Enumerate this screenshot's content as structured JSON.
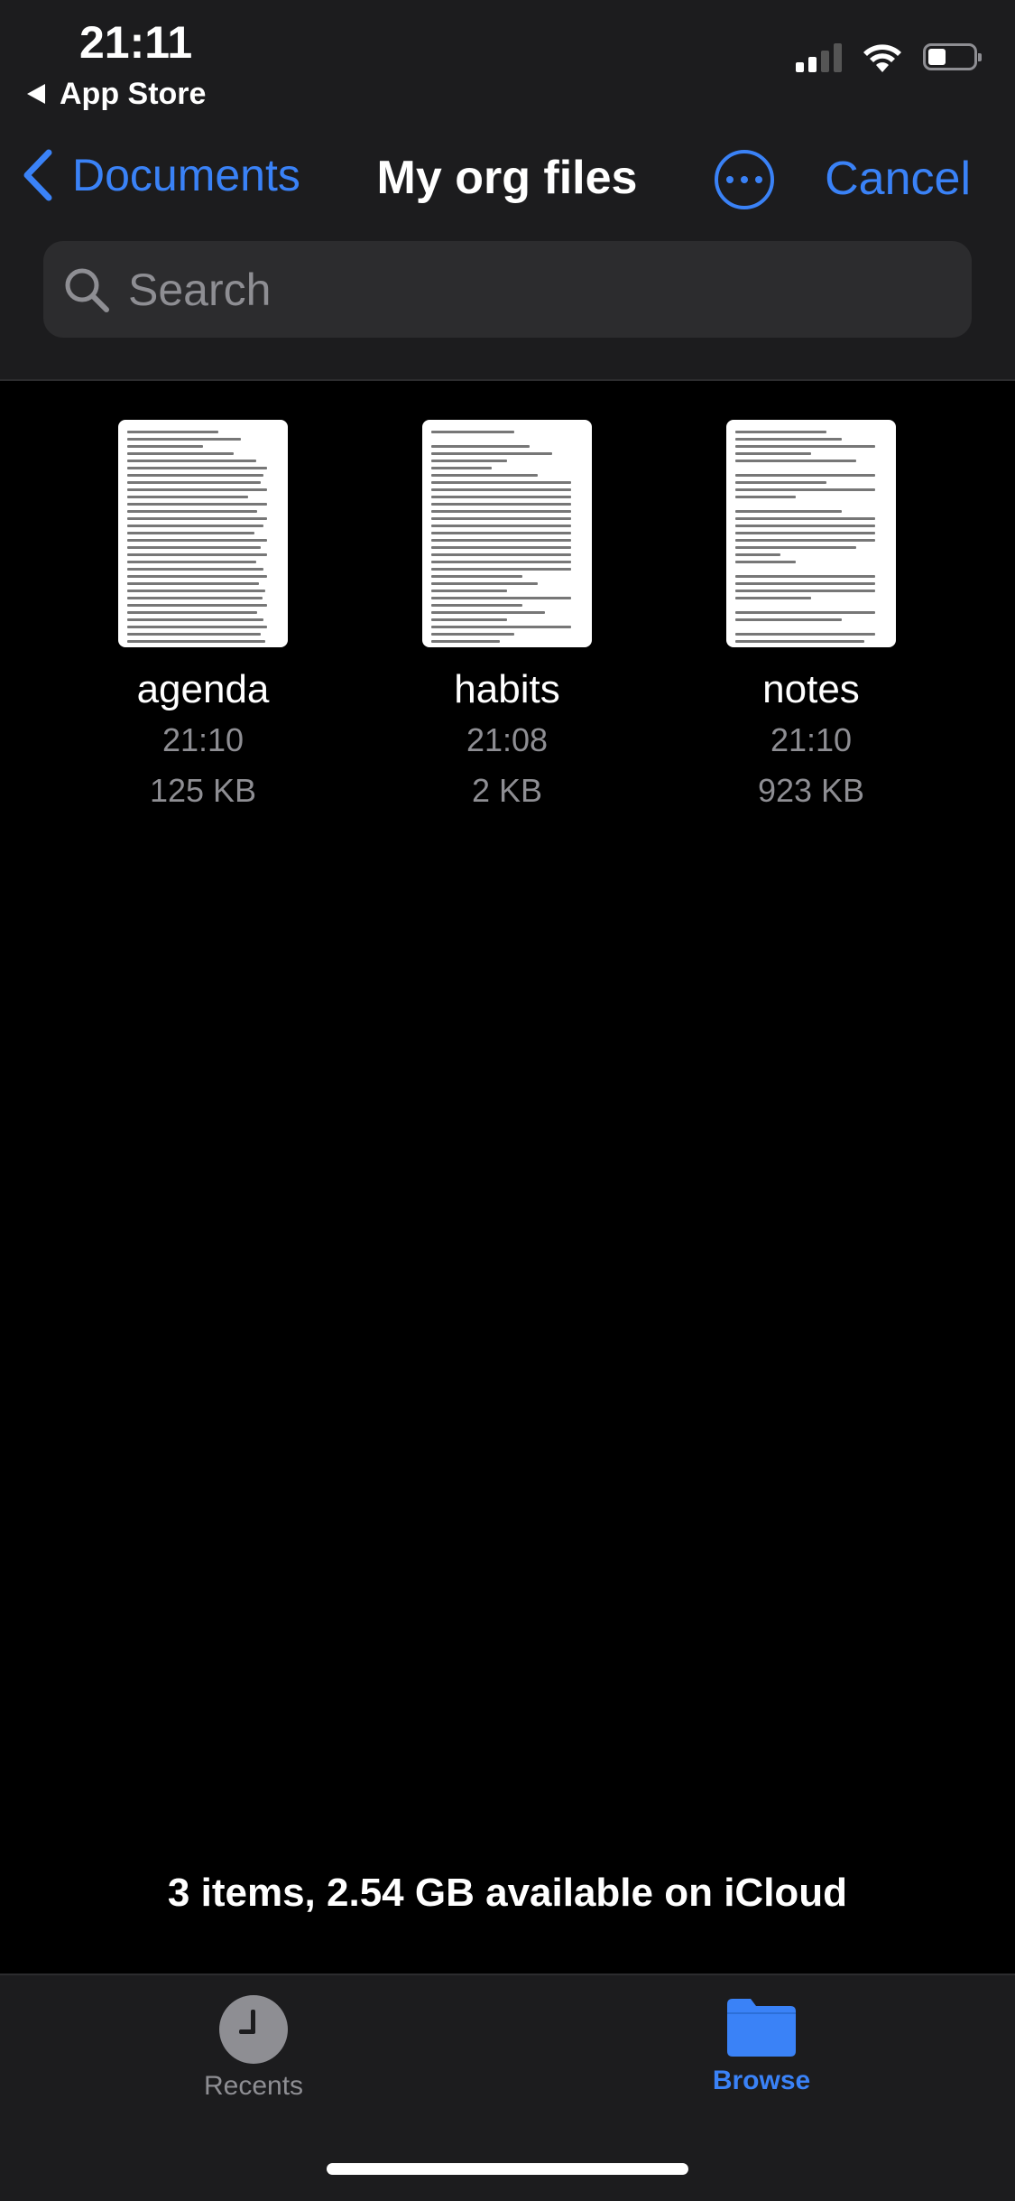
{
  "status_bar": {
    "time": "21:11",
    "back_app_label": "App Store"
  },
  "nav": {
    "back_label": "Documents",
    "title": "My org files",
    "cancel_label": "Cancel"
  },
  "search": {
    "placeholder": "Search"
  },
  "files": [
    {
      "name": "agenda",
      "time": "21:10",
      "size": "125 KB"
    },
    {
      "name": "habits",
      "time": "21:08",
      "size": "2 KB"
    },
    {
      "name": "notes",
      "time": "21:10",
      "size": "923 KB"
    }
  ],
  "footer": {
    "status": "3 items, 2.54 GB available on iCloud"
  },
  "tabbar": {
    "recents_label": "Recents",
    "browse_label": "Browse"
  },
  "colors": {
    "accent": "#3a82f7",
    "background": "#000000",
    "bar_background": "#1c1c1e",
    "secondary_text": "#8e8e93"
  }
}
